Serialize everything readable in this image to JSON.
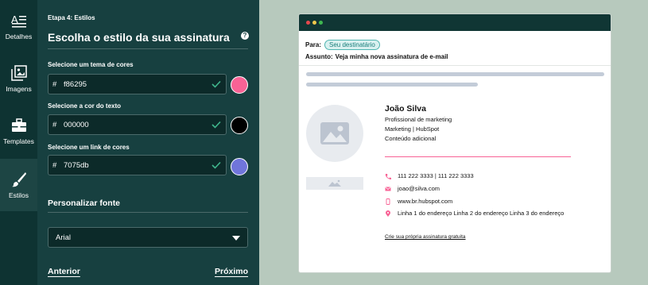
{
  "rail": {
    "items": [
      {
        "label": "Detalhes"
      },
      {
        "label": "Imagens"
      },
      {
        "label": "Templates"
      },
      {
        "label": "Estilos"
      }
    ]
  },
  "panel": {
    "step": "Etapa 4: Estilos",
    "heading": "Escolha o estilo da sua assinatura",
    "help_glyph": "?",
    "theme": {
      "label": "Selecione um tema de cores",
      "prefix": "#",
      "value": "f86295",
      "color": "#f86295"
    },
    "text_color": {
      "label": "Selecione a cor do texto",
      "prefix": "#",
      "value": "000000",
      "color": "#000000"
    },
    "link_color": {
      "label": "Selecione um link de cores",
      "prefix": "#",
      "value": "7075db",
      "color": "#7075db"
    },
    "font_section": "Personalizar fonte",
    "font_value": "Arial",
    "prev": "Anterior",
    "next": "Próximo"
  },
  "preview": {
    "to_label": "Para:",
    "to_value": "Seu destinatário",
    "subject_label": "Assunto:",
    "subject_value": "Veja minha nova assinatura de e-mail",
    "signature": {
      "name": "João Silva",
      "title": "Profissional de marketing",
      "department": "Marketing | HubSpot",
      "extra": "Conteúdo adicional",
      "phone": "111 222 3333 | 111 222 3333",
      "email": "joao@silva.com",
      "website": "www.br.hubspot.com",
      "address": "Linha 1 do endereço Linha 2 do endereço Linha 3 do endereço"
    },
    "create_link": "Crie sua própria assinatura gratuita"
  },
  "colors": {
    "rail_bg": "#0e3332",
    "panel_bg": "#174040",
    "accent": "#f86295",
    "window_dots": [
      "#e5484d",
      "#f2c94c",
      "#3fb950"
    ]
  }
}
